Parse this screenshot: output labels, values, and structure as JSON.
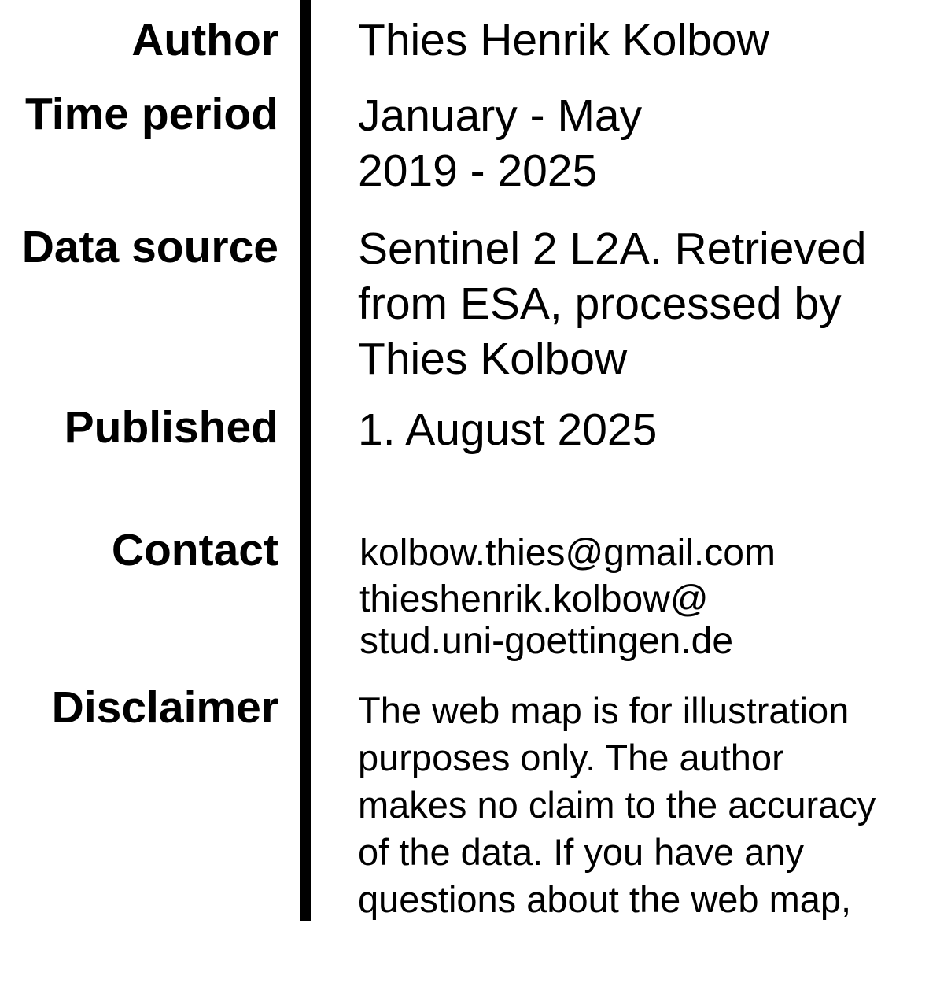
{
  "author": {
    "label": "Author",
    "value": "Thies Henrik Kolbow"
  },
  "time_period": {
    "label": "Time period",
    "lines": [
      "January - May",
      "2019 - 2025"
    ]
  },
  "data_source": {
    "label": "Data source",
    "lines": [
      "Sentinel 2 L2A. Retrieved",
      "from ESA, processed by",
      "Thies Kolbow"
    ]
  },
  "published": {
    "label": "Published",
    "value": "1. August 2025"
  },
  "contact": {
    "label": "Contact",
    "lines": [
      "kolbow.thies@gmail.com",
      "thieshenrik.kolbow@",
      "stud.uni-goettingen.de"
    ]
  },
  "disclaimer": {
    "label": "Disclaimer",
    "lines": [
      "The web map is for illustration",
      "purposes only. The author",
      "makes no claim to the accuracy",
      "of the data. If you have any",
      "questions about the web map,"
    ]
  }
}
